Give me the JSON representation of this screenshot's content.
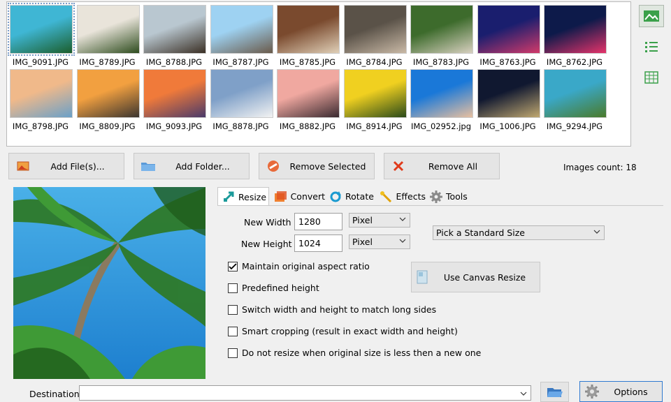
{
  "thumbnails": [
    {
      "name": "IMG_9091.JPG",
      "colors": [
        "#3fb6d4",
        "#1b5e2c"
      ],
      "selected": true
    },
    {
      "name": "IMG_8789.JPG",
      "colors": [
        "#e9e4da",
        "#2e4c1e"
      ]
    },
    {
      "name": "IMG_8788.JPG",
      "colors": [
        "#b9c7d0",
        "#3b3025"
      ]
    },
    {
      "name": "IMG_8787.JPG",
      "colors": [
        "#9ed2f2",
        "#6a5a4a"
      ]
    },
    {
      "name": "IMG_8785.JPG",
      "colors": [
        "#7a4a2e",
        "#e0d0b8"
      ]
    },
    {
      "name": "IMG_8784.JPG",
      "colors": [
        "#5a5248",
        "#c9b9a6"
      ]
    },
    {
      "name": "IMG_8783.JPG",
      "colors": [
        "#3d6b2c",
        "#d8d0c0"
      ]
    },
    {
      "name": "IMG_8763.JPG",
      "colors": [
        "#1a1e6e",
        "#d23a6a"
      ]
    },
    {
      "name": "IMG_8762.JPG",
      "colors": [
        "#0d1a4a",
        "#e5336a"
      ]
    },
    {
      "name": "IMG_8798.JPG",
      "colors": [
        "#f0b98a",
        "#6aa0c8"
      ]
    },
    {
      "name": "IMG_8809.JPG",
      "colors": [
        "#f2a040",
        "#3b3530"
      ]
    },
    {
      "name": "IMG_9093.JPG",
      "colors": [
        "#f07a3a",
        "#4a3a6a"
      ]
    },
    {
      "name": "IMG_8878.JPG",
      "colors": [
        "#7fa0c8",
        "#f2f2f2"
      ]
    },
    {
      "name": "IMG_8882.JPG",
      "colors": [
        "#f0a8a0",
        "#3a2a30"
      ]
    },
    {
      "name": "IMG_8914.JPG",
      "colors": [
        "#f0d020",
        "#2a4a1a"
      ]
    },
    {
      "name": "IMG_02952.jpg",
      "colors": [
        "#1a78d8",
        "#e8c0a0"
      ]
    },
    {
      "name": "IMG_1006.JPG",
      "colors": [
        "#101830",
        "#c0a870"
      ]
    },
    {
      "name": "IMG_9294.JPG",
      "colors": [
        "#3aa8c8",
        "#4a7a2a"
      ]
    }
  ],
  "buttons": {
    "add_files": "Add File(s)...",
    "add_folder": "Add Folder...",
    "remove_selected": "Remove Selected",
    "remove_all": "Remove All"
  },
  "images_count": "Images count: 18",
  "tabs": [
    "Resize",
    "Convert",
    "Rotate",
    "Effects",
    "Tools"
  ],
  "resize": {
    "new_width_label": "New Width",
    "new_width_value": "1280",
    "new_height_label": "New Height",
    "new_height_value": "1024",
    "width_unit": "Pixel",
    "height_unit": "Pixel",
    "standard_size": "Pick a Standard Size",
    "options": [
      {
        "label": "Maintain original aspect ratio",
        "checked": true
      },
      {
        "label": "Predefined height",
        "checked": false
      },
      {
        "label": "Switch width and height to match long sides",
        "checked": false
      },
      {
        "label": "Smart cropping (result in exact width and height)",
        "checked": false
      },
      {
        "label": "Do not resize when original size is less then a new one",
        "checked": false
      }
    ],
    "canvas_button": "Use Canvas Resize"
  },
  "destination": {
    "label": "Destination",
    "value": ""
  },
  "options_button": "Options",
  "colors": {
    "accent": "#2f7ad0",
    "green_icon": "#2e9a3e"
  }
}
